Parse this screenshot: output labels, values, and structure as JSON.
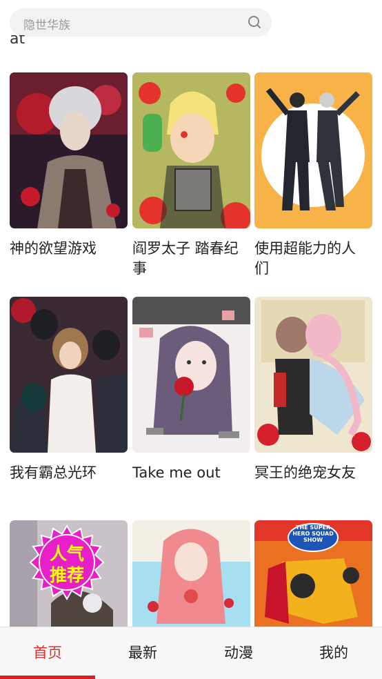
{
  "search": {
    "placeholder": "隐世华族"
  },
  "cut_off_text": "at",
  "comics": [
    {
      "title": "神的欲望游戏"
    },
    {
      "title": "阎罗太子 踏春纪事"
    },
    {
      "title": "使用超能力的人们"
    },
    {
      "title": "我有霸总光环"
    },
    {
      "title": "Take me out"
    },
    {
      "title": "冥王的绝宠女友"
    },
    {
      "title": "",
      "badge": "人气推荐"
    },
    {
      "title": ""
    },
    {
      "title": "",
      "cover_text": "THE SUPER HERO SQUAD SHOW"
    }
  ],
  "nav": {
    "items": [
      {
        "label": "首页"
      },
      {
        "label": "最新"
      },
      {
        "label": "动漫"
      },
      {
        "label": "我的"
      }
    ],
    "active_index": 0
  },
  "colors": {
    "accent": "#e02d2d",
    "badge_fill": "#e81ec8",
    "badge_text": "#ffff00"
  }
}
